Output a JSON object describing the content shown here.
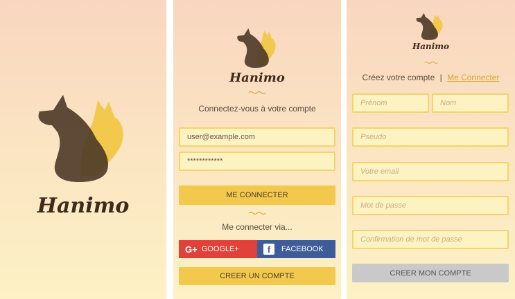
{
  "brand": {
    "name": "Hanimo"
  },
  "splash": {},
  "login": {
    "subtitle": "Connectez-vous à votre compte",
    "email_value": "user@example.com",
    "password_value": "************",
    "login_button": "ME CONNECTER",
    "via_text": "Me connecter via...",
    "google_label": "GOOGLE+",
    "facebook_label": "FACEBOOK",
    "create_account_button": "CREER UN COMPTE"
  },
  "signup": {
    "heading": "Créez votre compte",
    "separator": "|",
    "login_link": "Me Connecter",
    "firstname_placeholder": "Prénom",
    "lastname_placeholder": "Nom",
    "username_placeholder": "Pseudo",
    "email_placeholder": "Votre email",
    "password_placeholder": "Mot de passe",
    "confirm_placeholder": "Confirmation de mot de passe",
    "submit_button": "CREER MON COMPTE"
  },
  "colors": {
    "accent_yellow": "#f2c94c",
    "field_border": "#f3d46a",
    "google_red": "#e0413a",
    "facebook_blue": "#3f5c9a",
    "brand_brown": "#3f2a1e"
  }
}
